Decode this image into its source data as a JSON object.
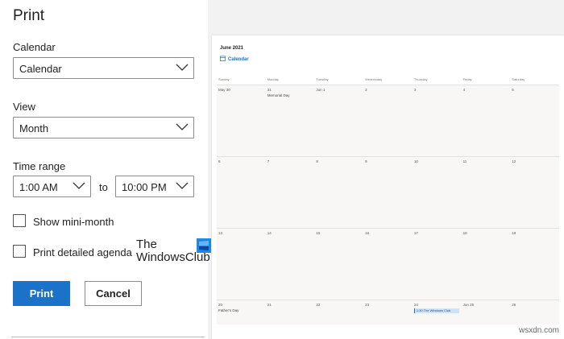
{
  "panel": {
    "title": "Print",
    "calendar": {
      "label": "Calendar",
      "value": "Calendar"
    },
    "view": {
      "label": "View",
      "value": "Month"
    },
    "time_range": {
      "label": "Time range",
      "from": "1:00 AM",
      "to_label": "to",
      "to": "10:00 PM"
    },
    "options": {
      "mini_month": {
        "label": "Show mini-month",
        "checked": false
      },
      "agenda": {
        "label": "Print detailed agenda",
        "checked": false
      }
    },
    "buttons": {
      "print": "Print",
      "cancel": "Cancel"
    },
    "watermark": {
      "line1": "The",
      "line2": "WindowsClub"
    }
  },
  "preview": {
    "month_title": "June 2021",
    "calendar_name": "Calendar",
    "day_headers": [
      "Sunday",
      "Monday",
      "Tuesday",
      "Wednesday",
      "Thursday",
      "Friday",
      "Saturday"
    ],
    "weeks": [
      {
        "days": [
          "May 30",
          "31",
          "Jun 1",
          "2",
          "3",
          "4",
          "5"
        ],
        "events": [
          {
            "day": 1,
            "text": "Memorial Day"
          }
        ]
      },
      {
        "days": [
          "6",
          "7",
          "8",
          "9",
          "10",
          "11",
          "12"
        ],
        "events": []
      },
      {
        "days": [
          "13",
          "14",
          "15",
          "16",
          "17",
          "18",
          "19"
        ],
        "events": []
      },
      {
        "days": [
          "20",
          "21",
          "22",
          "23",
          "24",
          "Jun 25",
          "26"
        ],
        "events": [
          {
            "day": 0,
            "text": "Father's Day"
          },
          {
            "day": 4,
            "text": "1:30 The Windows Club",
            "highlight": true
          }
        ]
      }
    ]
  },
  "credit": "wsxdn.com",
  "colors": {
    "accent": "#1a73c9",
    "preview_bg": "#f2f2f2",
    "cell_bg": "#f8f7f5"
  }
}
